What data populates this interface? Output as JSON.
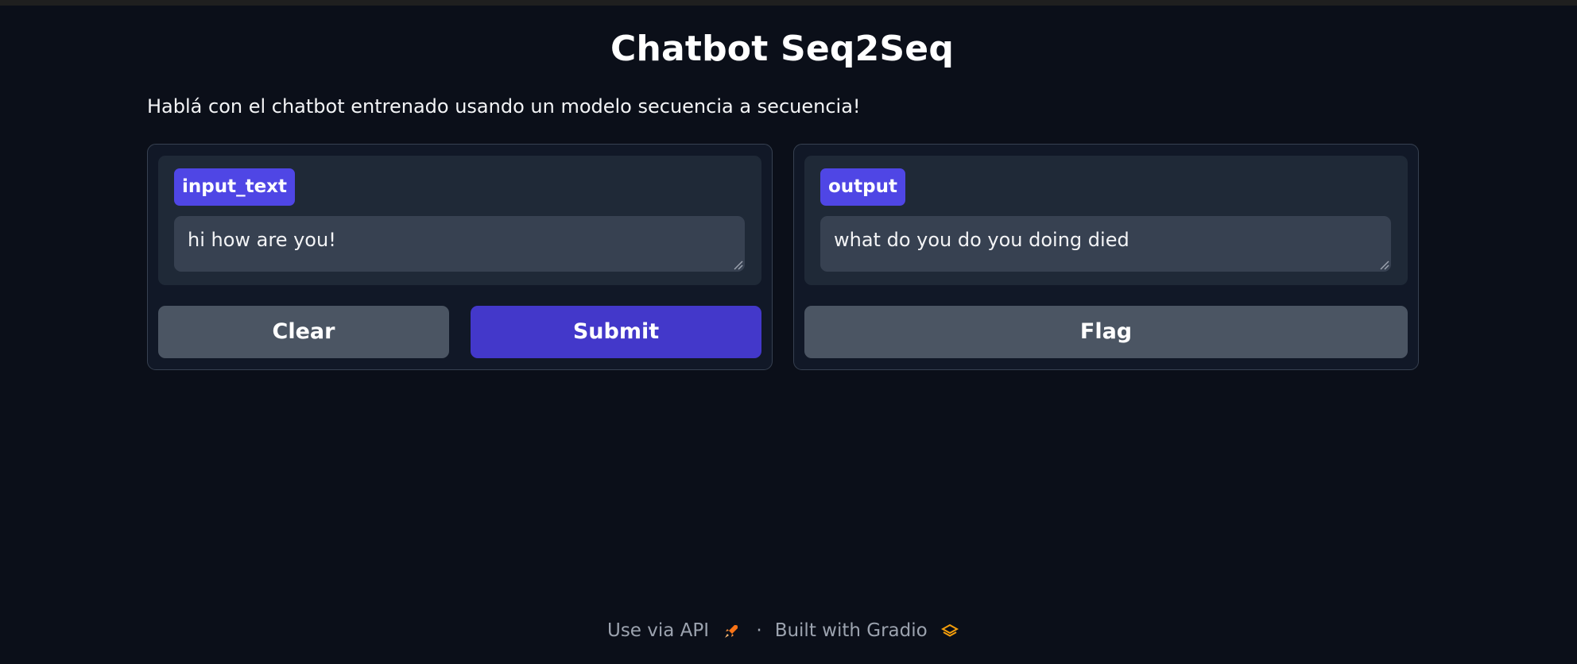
{
  "page": {
    "title": "Chatbot Seq2Seq",
    "description": "Hablá con el chatbot entrenado usando un modelo secuencia a secuencia!"
  },
  "input_panel": {
    "label": "input_text",
    "value": "hi how are you!",
    "clear_label": "Clear",
    "submit_label": "Submit"
  },
  "output_panel": {
    "label": "output",
    "value": "what do you do you doing died",
    "flag_label": "Flag"
  },
  "footer": {
    "api_label": "Use via API",
    "separator": "·",
    "built_with_label": "Built with Gradio"
  },
  "colors": {
    "background": "#0b0f19",
    "accent": "#4f46e5",
    "primary_button": "#4338ca",
    "secondary_button": "#4b5563"
  },
  "icons": {
    "api": "rocket-icon",
    "gradio": "gradio-logo-icon"
  }
}
